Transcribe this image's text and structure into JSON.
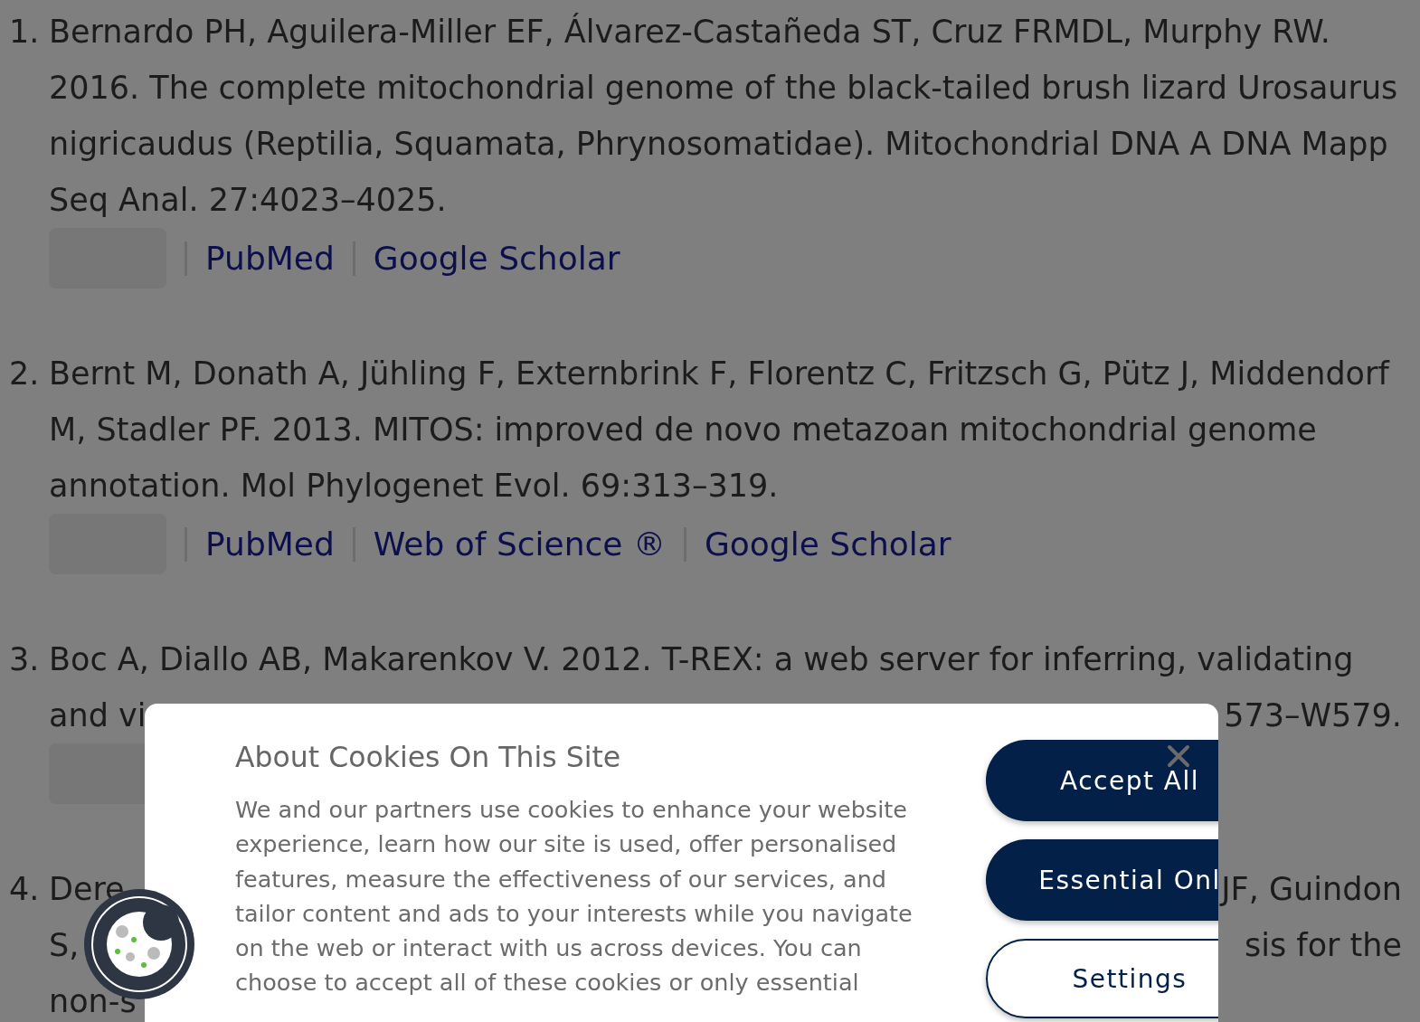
{
  "references": [
    {
      "number": "1.",
      "rows": [
        {
          "kind": "text",
          "left": "Bernardo PH, Aguilera-Miller EF, Álvarez-Castañeda ST, Cruz FRMDL, Murphy RW."
        },
        {
          "kind": "text",
          "left": "2016. The complete mitochondrial genome of the black-tailed brush lizard Urosaurus"
        },
        {
          "kind": "text",
          "left": "nigricaudus (Reptilia, Squamata, Phrynosomatidae). Mitochondrial DNA A DNA Mapp"
        },
        {
          "kind": "text",
          "left": "Seq Anal. 27:4023–4025."
        },
        {
          "kind": "links",
          "links": [
            "PubMed",
            "Google Scholar"
          ]
        }
      ]
    },
    {
      "number": "2.",
      "rows": [
        {
          "kind": "text",
          "left": "Bernt M, Donath A, Jühling F, Externbrink F, Florentz C, Fritzsch G, Pütz J, Middendorf"
        },
        {
          "kind": "text",
          "left": "M, Stadler PF. 2013. MITOS: improved de novo metazoan mitochondrial genome"
        },
        {
          "kind": "text",
          "left": "annotation. Mol Phylogenet Evol. 69:313–319."
        },
        {
          "kind": "links",
          "links": [
            "PubMed",
            "Web of Science ®",
            "Google Scholar"
          ]
        }
      ]
    },
    {
      "number": "3.",
      "rows": [
        {
          "kind": "text",
          "left": "Boc A, Diallo AB, Makarenkov V. 2012. T-REX: a web server for inferring, validating"
        },
        {
          "kind": "text",
          "left": "and vi",
          "right": "573–W579."
        },
        {
          "kind": "links"
        }
      ]
    },
    {
      "number": "4.",
      "rows": [
        {
          "kind": "text",
          "left": "Dere",
          "right": "JF, Guindon"
        },
        {
          "kind": "text",
          "left": "S,",
          "right": "sis for the"
        },
        {
          "kind": "text",
          "left": "non-s"
        }
      ]
    }
  ],
  "cookie_dialog": {
    "title": "About Cookies On This Site",
    "body": "We and our partners use cookies to enhance your website experience, learn how our site is used, offer personalised features, measure the effectiveness of our services, and tailor content and ads to your interests while you navigate on the web or interact with us across devices. You can choose to accept all of these cookies or only essential",
    "buttons": [
      {
        "label": "Accept All",
        "kind": "primary"
      },
      {
        "label": "Essential Onl",
        "kind": "primary"
      },
      {
        "label": "Settings",
        "kind": "outline"
      }
    ]
  }
}
